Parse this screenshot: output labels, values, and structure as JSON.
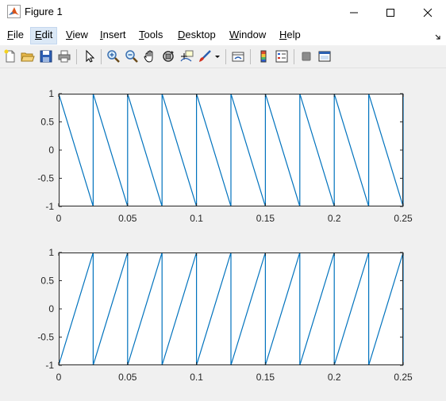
{
  "window": {
    "title": "Figure 1"
  },
  "menu": {
    "items": [
      {
        "label": "File",
        "mnemonic": "F",
        "rest": "ile"
      },
      {
        "label": "Edit",
        "mnemonic": "E",
        "rest": "dit"
      },
      {
        "label": "View",
        "mnemonic": "V",
        "rest": "iew"
      },
      {
        "label": "Insert",
        "mnemonic": "I",
        "rest": "nsert"
      },
      {
        "label": "Tools",
        "mnemonic": "T",
        "rest": "ools"
      },
      {
        "label": "Desktop",
        "mnemonic": "D",
        "rest": "esktop"
      },
      {
        "label": "Window",
        "mnemonic": "W",
        "rest": "indow"
      },
      {
        "label": "Help",
        "mnemonic": "H",
        "rest": "elp"
      }
    ],
    "active": "Edit"
  },
  "toolbar": {
    "icons": [
      "new-figure-icon",
      "open-file-icon",
      "save-icon",
      "print-icon",
      "pointer-icon",
      "zoom-in-icon",
      "zoom-out-icon",
      "pan-hand-icon",
      "rotate-3d-icon",
      "data-cursor-icon",
      "brush-icon",
      "brush-dropdown-icon",
      "link-plot-icon",
      "insert-colorbar-icon",
      "insert-legend-icon",
      "hide-plot-tools-icon",
      "show-plot-tools-icon"
    ]
  },
  "colors": {
    "line": "#0072BD",
    "axes_bg": "#ffffff",
    "figure_bg": "#f0f0f0",
    "accent_menu": "#dbe8f6"
  },
  "chart_data": [
    {
      "type": "line",
      "title": "",
      "xlabel": "",
      "ylabel": "",
      "xlim": [
        0,
        0.25
      ],
      "ylim": [
        -1,
        1
      ],
      "xticks": [
        "0",
        "0.05",
        "0.1",
        "0.15",
        "0.2",
        "0.25"
      ],
      "yticks": [
        "1",
        "0.5",
        "0",
        "-0.5",
        "-1"
      ],
      "grid": false,
      "series": [
        {
          "x": [
            0,
            0.025,
            0.025,
            0.05,
            0.05,
            0.075,
            0.075,
            0.1,
            0.1,
            0.125,
            0.125,
            0.15,
            0.15,
            0.175,
            0.175,
            0.2,
            0.2,
            0.225,
            0.225,
            0.25,
            0.25
          ],
          "y": [
            1,
            -1,
            1,
            -1,
            1,
            -1,
            1,
            -1,
            1,
            -1,
            1,
            -1,
            1,
            -1,
            1,
            -1,
            1,
            -1,
            1,
            -1,
            1
          ]
        }
      ]
    },
    {
      "type": "line",
      "title": "",
      "xlabel": "",
      "ylabel": "",
      "xlim": [
        0,
        0.25
      ],
      "ylim": [
        -1,
        1
      ],
      "xticks": [
        "0",
        "0.05",
        "0.1",
        "0.15",
        "0.2",
        "0.25"
      ],
      "yticks": [
        "1",
        "0.5",
        "0",
        "-0.5",
        "-1"
      ],
      "grid": false,
      "series": [
        {
          "x": [
            0,
            0.025,
            0.025,
            0.05,
            0.05,
            0.075,
            0.075,
            0.1,
            0.1,
            0.125,
            0.125,
            0.15,
            0.15,
            0.175,
            0.175,
            0.2,
            0.2,
            0.225,
            0.225,
            0.25,
            0.25
          ],
          "y": [
            -1,
            1,
            -1,
            1,
            -1,
            1,
            -1,
            1,
            -1,
            1,
            -1,
            1,
            -1,
            1,
            -1,
            1,
            -1,
            1,
            -1,
            1,
            -1
          ]
        }
      ]
    }
  ]
}
